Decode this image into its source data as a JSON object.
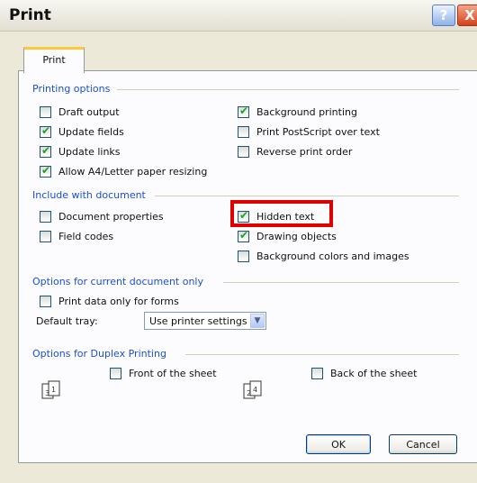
{
  "window": {
    "title": "Print",
    "help_label": "?",
    "close_label": "X"
  },
  "tab": {
    "label": "Print"
  },
  "printing_options": {
    "title": "Printing options",
    "items": [
      {
        "label": "Draft output",
        "checked": false
      },
      {
        "label": "Update fields",
        "checked": true
      },
      {
        "label": "Update links",
        "checked": true
      },
      {
        "label": "Allow A4/Letter paper resizing",
        "checked": true
      },
      {
        "label": "Background printing",
        "checked": true
      },
      {
        "label": "Print PostScript over text",
        "checked": false
      },
      {
        "label": "Reverse print order",
        "checked": false
      }
    ]
  },
  "include_with_document": {
    "title": "Include with document",
    "items": [
      {
        "label": "Document properties",
        "checked": false
      },
      {
        "label": "Field codes",
        "checked": false
      },
      {
        "label": "Hidden text",
        "checked": true
      },
      {
        "label": "Drawing objects",
        "checked": true
      },
      {
        "label": "Background colors and images",
        "checked": false
      }
    ]
  },
  "current_document": {
    "title": "Options for current document only",
    "print_data_only": {
      "label": "Print data only for forms",
      "checked": false
    },
    "default_tray_label": "Default tray:",
    "default_tray_value": "Use printer settings"
  },
  "duplex": {
    "title": "Options for Duplex Printing",
    "front": {
      "label": "Front of the sheet",
      "checked": false
    },
    "back": {
      "label": "Back of the sheet",
      "checked": false
    }
  },
  "buttons": {
    "ok": "OK",
    "cancel": "Cancel"
  },
  "colors": {
    "group_title": "#1d4fd0",
    "highlight": "#e00000",
    "check": "#21a121",
    "tab_accent": "#ffc83c"
  }
}
